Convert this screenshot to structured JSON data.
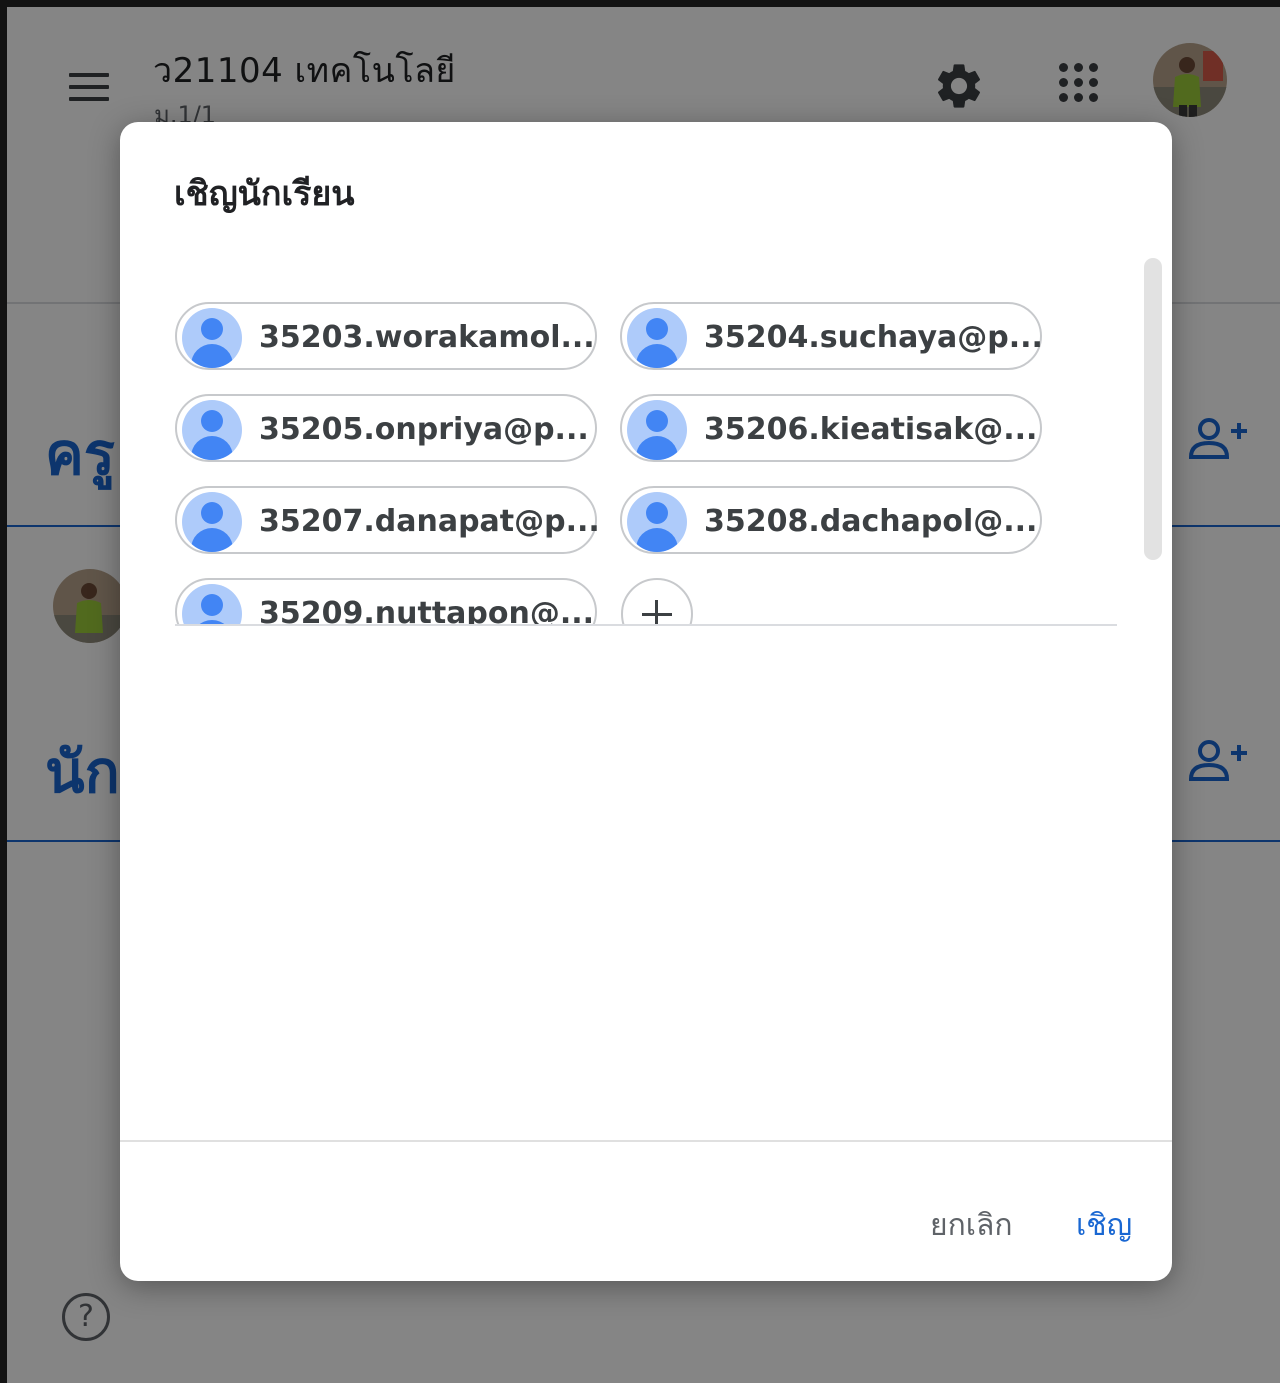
{
  "header": {
    "class_title": "ว21104 เทคโนโลยี",
    "class_section": "ม.1/1",
    "icons": {
      "menu": "menu-icon",
      "settings": "gear-icon",
      "apps": "apps-grid-icon",
      "avatar": "avatar"
    }
  },
  "background": {
    "teachers_heading": "ครู",
    "students_heading": "นัก",
    "accent_color": "#1967d2"
  },
  "dialog": {
    "title": "เชิญนักเรียน",
    "chips": [
      {
        "label": "35203.worakamol..."
      },
      {
        "label": "35204.suchaya@p..."
      },
      {
        "label": "35205.onpriya@p..."
      },
      {
        "label": "35206.kieatisak@..."
      },
      {
        "label": "35207.danapat@p..."
      },
      {
        "label": "35208.dachapol@..."
      },
      {
        "label": "35209.nuttapon@..."
      }
    ],
    "cancel_label": "ยกเลิก",
    "invite_label": "เชิญ"
  }
}
